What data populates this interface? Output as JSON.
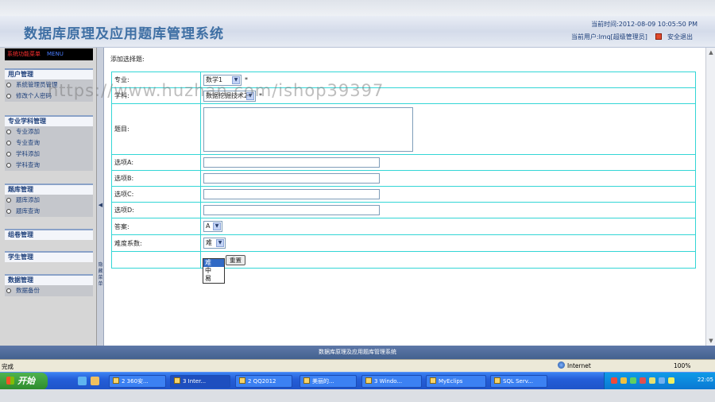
{
  "header": {
    "title": "数据库原理及应用题库管理系统",
    "current_time": "当前时间:2012-08-09 10:05:50 PM",
    "current_user": "当前用户:lmq[超级管理员]",
    "logout": "安全退出"
  },
  "sidebar": {
    "system_menu": "系统功能菜单",
    "system_menu_extra": "MENU",
    "groups": [
      {
        "title": "用户管理",
        "items": [
          "系统管理员管理",
          "修改个人密码"
        ]
      },
      {
        "title": "专业学科管理",
        "items": [
          "专业添加",
          "专业查询",
          "学科添加",
          "学科查询"
        ]
      },
      {
        "title": "题库管理",
        "items": [
          "题库添加",
          "题库查询"
        ]
      },
      {
        "title": "组卷管理",
        "items": []
      },
      {
        "title": "学生管理",
        "items": []
      },
      {
        "title": "数据管理",
        "items": [
          "数据备份"
        ]
      }
    ],
    "splitter_label": "隐藏菜单"
  },
  "content": {
    "section_title": "添加选择题:",
    "fields": {
      "major_label": "专业:",
      "major_value": "数学1",
      "subject_label": "学科:",
      "subject_value": "数据挖掘技术2",
      "question_label": "题目:",
      "option_a_label": "选项A:",
      "option_b_label": "选项B:",
      "option_c_label": "选项C:",
      "option_d_label": "选项D:",
      "answer_label": "答案:",
      "answer_value": "A",
      "difficulty_label": "难度系数:",
      "difficulty_value": "难",
      "difficulty_options": [
        "难",
        "中",
        "易"
      ],
      "required_mark": "*"
    },
    "buttons": {
      "reset": "重置"
    }
  },
  "footer": {
    "text": "数据库原理及应用题库管理系统"
  },
  "statusbar": {
    "status": "完成",
    "zone": "Internet",
    "zoom": "100%"
  },
  "taskbar": {
    "start": "开始",
    "tasks": [
      "2 360安...",
      "3 Inter...",
      "2 QQ2012",
      "美丽的...",
      "3 Windo...",
      "MyEclips",
      "SQL Serv..."
    ],
    "clock": "22:05"
  },
  "watermark": "https://www.huzhan.com/ishop39397"
}
